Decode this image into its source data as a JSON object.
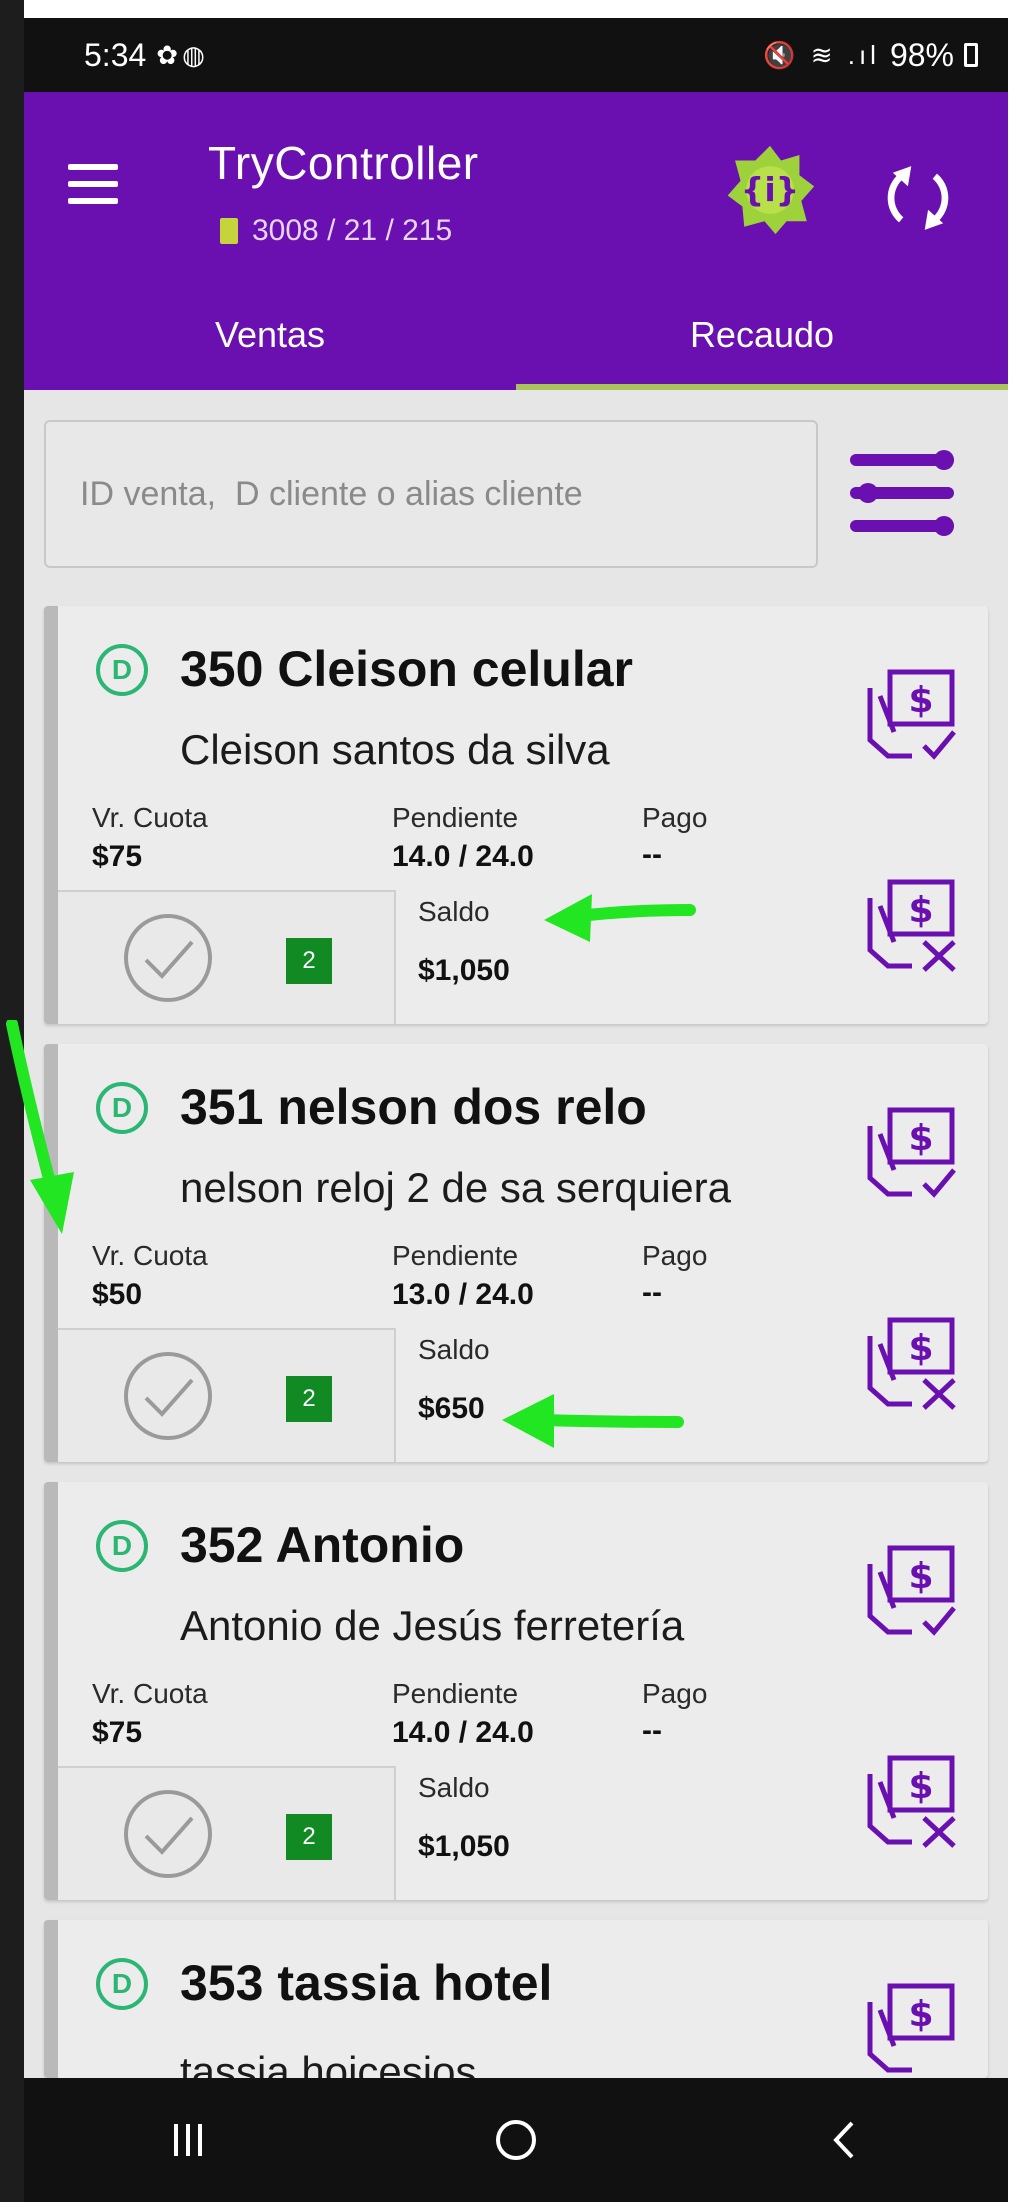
{
  "status_bar": {
    "time": "5:34",
    "left_icons": "✿◍",
    "right_icons": "🔇 ≋ .ıl",
    "battery": "98%"
  },
  "app_bar": {
    "title": "TryController",
    "subtitle": "3008 / 21 / 215",
    "menu_icon": "hamburger-icon",
    "badge_icon": "badge-icon",
    "sync_icon": "sync-icon",
    "brand_color": "#6a0fb0"
  },
  "tabs": [
    {
      "label": "Ventas",
      "active": false
    },
    {
      "label": "Recaudo",
      "active": true
    }
  ],
  "search": {
    "placeholder": "ID venta,  D cliente o alias cliente",
    "value": ""
  },
  "labels": {
    "cuota": "Vr. Cuota",
    "pendiente": "Pendiente",
    "pago": "Pago",
    "saldo": "Saldo"
  },
  "sales": [
    {
      "badge": "D",
      "title": "350 Cleison celular",
      "client": "Cleison santos da silva",
      "cuota": "$75",
      "pendiente": "14.0 / 24.0",
      "pago": "--",
      "saldo": "$1,050",
      "count": "2"
    },
    {
      "badge": "D",
      "title": "351 nelson dos relo",
      "client": "nelson reloj 2 de sa serquiera",
      "cuota": "$50",
      "pendiente": "13.0 / 24.0",
      "pago": "--",
      "saldo": "$650",
      "count": "2"
    },
    {
      "badge": "D",
      "title": "352 Antonio",
      "client": "Antonio de Jesús ferretería",
      "cuota": "$75",
      "pendiente": "14.0 / 24.0",
      "pago": "--",
      "saldo": "$1,050",
      "count": "2"
    },
    {
      "badge": "D",
      "title": "353 tassia hotel",
      "client": "tassia hoicesios"
    }
  ],
  "colors": {
    "accent_green": "#2bb673",
    "annotation_arrow": "#22e622",
    "count_badge": "#118a24"
  }
}
